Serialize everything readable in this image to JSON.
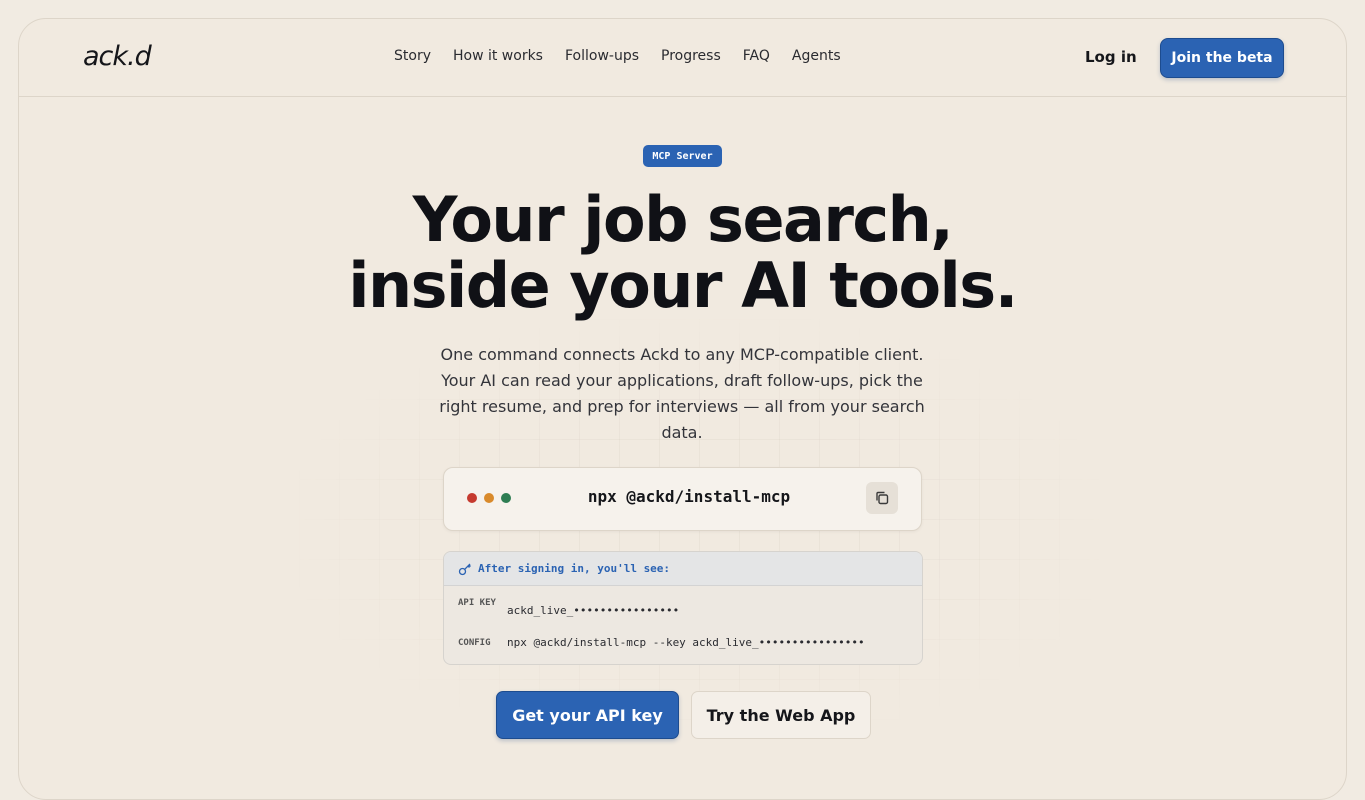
{
  "header": {
    "logo": "ack.d",
    "nav": [
      "Story",
      "How it works",
      "Follow-ups",
      "Progress",
      "FAQ",
      "Agents"
    ],
    "login_label": "Log in",
    "join_label": "Join the beta"
  },
  "hero": {
    "badge": "MCP Server",
    "headline_line1": "Your job search,",
    "headline_line2": "inside your AI tools.",
    "subtext": "One command connects Ackd to any MCP-compatible client. Your AI can read your applications, draft follow-ups, pick the right resume, and prep for interviews — all from your search data.",
    "command": "npx @ackd/install-mcp",
    "copy_icon": "copy-icon"
  },
  "info": {
    "key_icon": "key-icon",
    "heading": "After signing in, you'll see:",
    "api_key_label": "API KEY",
    "api_key_value": "ackd_live_••••••••••••••••",
    "config_label": "CONFIG",
    "config_value": "npx @ackd/install-mcp --key ackd_live_••••••••••••••••"
  },
  "cta": {
    "primary": "Get your API key",
    "secondary": "Try the Web App"
  },
  "colors": {
    "accent": "#2b63b3",
    "background": "#f1ebe2",
    "dot_red": "#c53a2f",
    "dot_amber": "#d98a2b",
    "dot_green": "#2e7d52"
  }
}
